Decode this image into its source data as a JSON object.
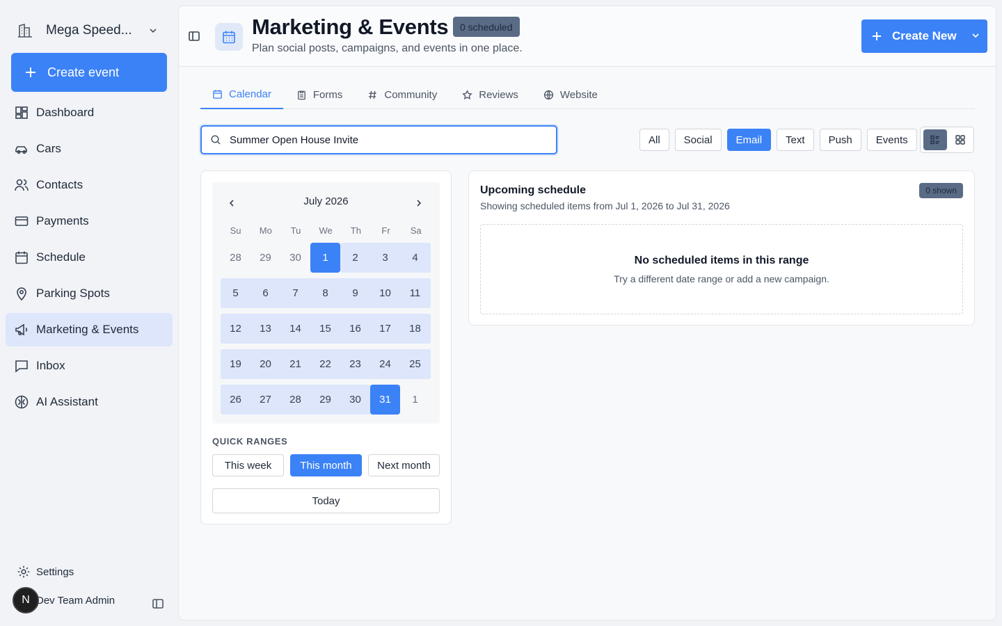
{
  "sidebar": {
    "workspace_name": "Mega Speed...",
    "create_event_label": "Create event",
    "items": [
      {
        "label": "Dashboard",
        "icon": "dashboard-icon"
      },
      {
        "label": "Cars",
        "icon": "car-icon"
      },
      {
        "label": "Contacts",
        "icon": "users-icon"
      },
      {
        "label": "Payments",
        "icon": "credit-card-icon"
      },
      {
        "label": "Schedule",
        "icon": "calendar-icon"
      },
      {
        "label": "Parking Spots",
        "icon": "map-pin-icon"
      },
      {
        "label": "Marketing & Events",
        "icon": "megaphone-icon",
        "active": true
      },
      {
        "label": "Inbox",
        "icon": "message-square-icon"
      },
      {
        "label": "AI Assistant",
        "icon": "brain-icon"
      }
    ],
    "settings_label": "Settings",
    "user": {
      "initial": "N",
      "name": "Dev Team Admin"
    }
  },
  "header": {
    "title": "Marketing & Events",
    "badge": "0 scheduled",
    "subtitle": "Plan social posts, campaigns, and events in one place.",
    "create_new_label": "Create New"
  },
  "tabs": [
    {
      "label": "Calendar",
      "icon": "calendar-icon",
      "active": true
    },
    {
      "label": "Forms",
      "icon": "clipboard-icon"
    },
    {
      "label": "Community",
      "icon": "hash-icon"
    },
    {
      "label": "Reviews",
      "icon": "star-icon"
    },
    {
      "label": "Website",
      "icon": "globe-icon"
    }
  ],
  "search": {
    "value": "Summer Open House Invite",
    "placeholder": ""
  },
  "filters": [
    {
      "label": "All"
    },
    {
      "label": "Social"
    },
    {
      "label": "Email",
      "active": true
    },
    {
      "label": "Text"
    },
    {
      "label": "Push"
    },
    {
      "label": "Events"
    }
  ],
  "calendar": {
    "month_label": "July 2026",
    "weekdays": [
      "Su",
      "Mo",
      "Tu",
      "We",
      "Th",
      "Fr",
      "Sa"
    ],
    "weeks": [
      [
        "28",
        "29",
        "30",
        "1",
        "2",
        "3",
        "4"
      ],
      [
        "5",
        "6",
        "7",
        "8",
        "9",
        "10",
        "11"
      ],
      [
        "12",
        "13",
        "14",
        "15",
        "16",
        "17",
        "18"
      ],
      [
        "19",
        "20",
        "21",
        "22",
        "23",
        "24",
        "25"
      ],
      [
        "26",
        "27",
        "28",
        "29",
        "30",
        "31",
        "1"
      ]
    ],
    "quick_ranges_label": "QUICK RANGES",
    "quick_ranges": [
      {
        "label": "This week"
      },
      {
        "label": "This month",
        "active": true
      },
      {
        "label": "Next month"
      }
    ],
    "today_label": "Today"
  },
  "upcoming": {
    "title": "Upcoming schedule",
    "subtitle": "Showing scheduled items from Jul 1, 2026 to Jul 31, 2026",
    "badge": "0 shown",
    "empty_title": "No scheduled items in this range",
    "empty_subtitle": "Try a different date range or add a new campaign."
  },
  "colors": {
    "accent": "#3b82f6",
    "active_nav_bg": "#dde6fb",
    "badge_bg": "#5a6b86"
  }
}
